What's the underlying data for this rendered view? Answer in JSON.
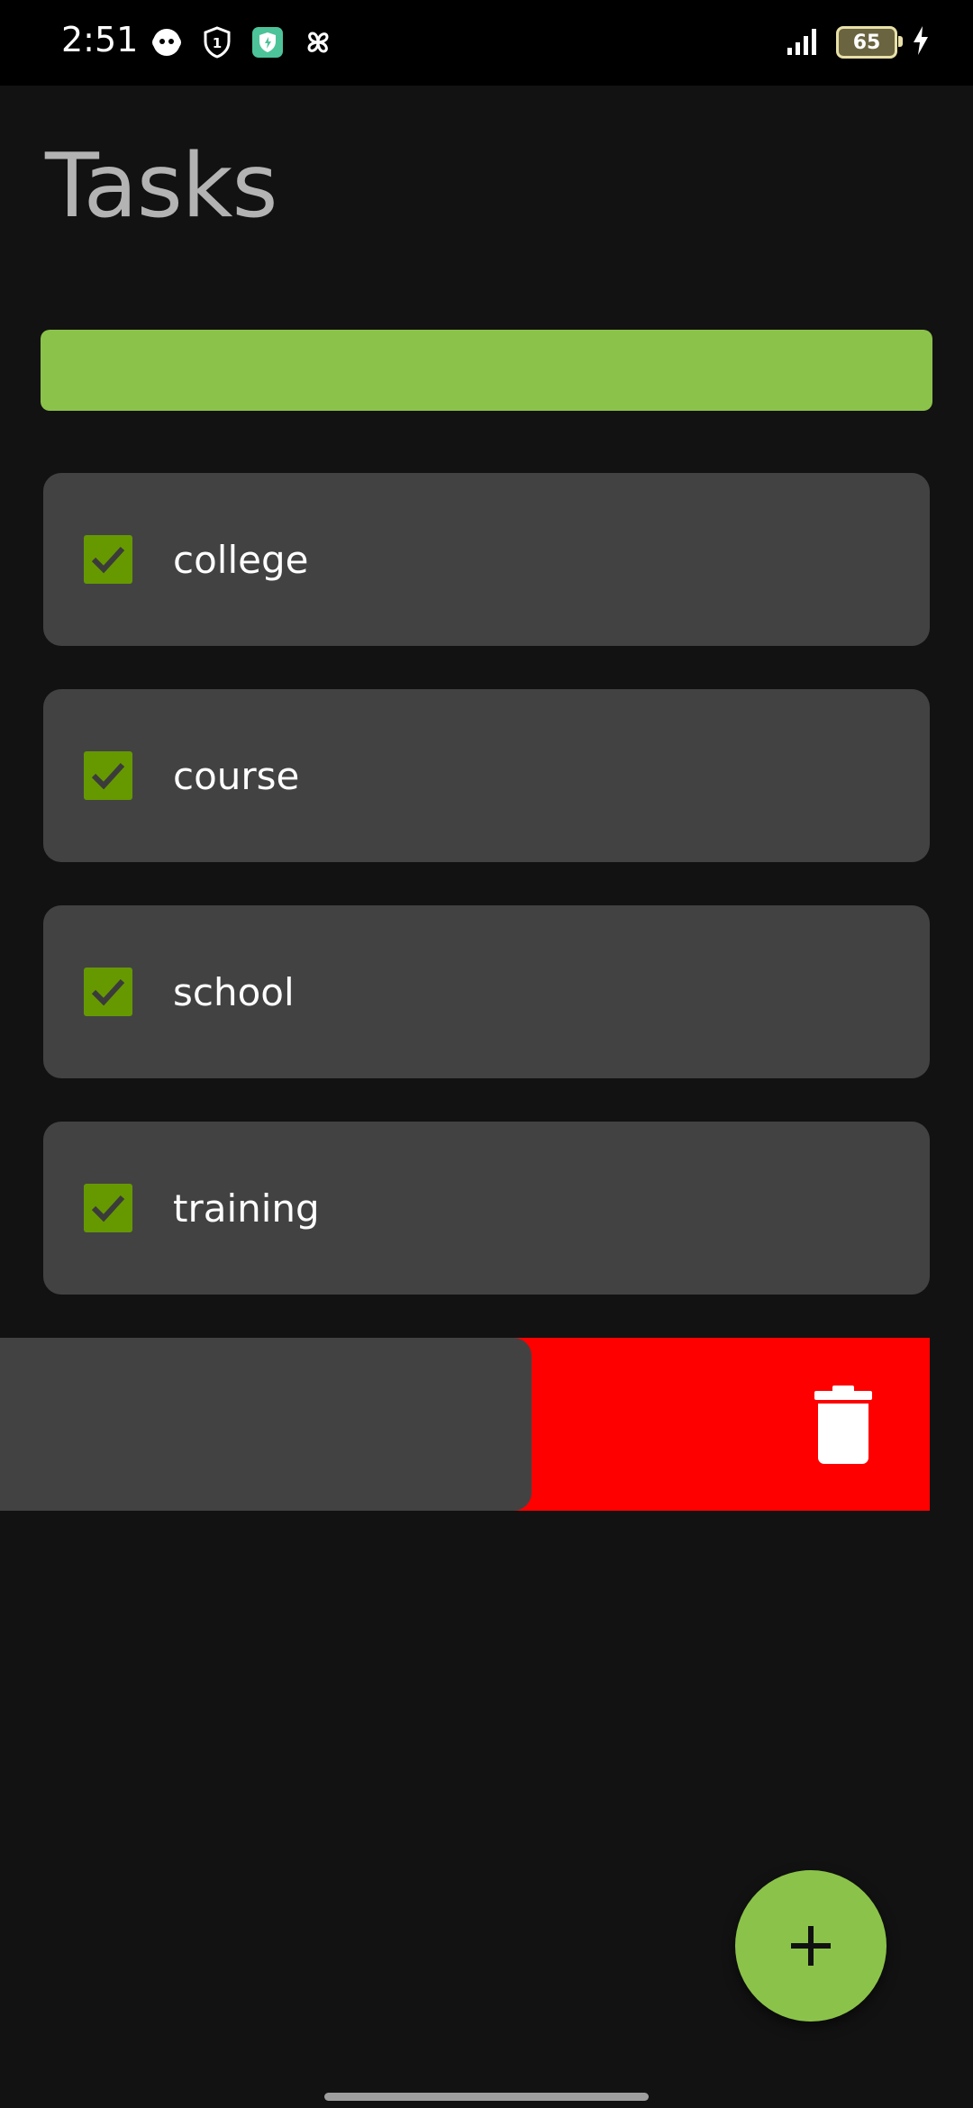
{
  "status_bar": {
    "time": "2:51",
    "battery_level": "65",
    "left_icons": [
      "assistant-icon",
      "shield-1-icon",
      "vpn-shield-icon",
      "pinwheel-icon"
    ],
    "right_icons": [
      "signal-icon",
      "battery-icon",
      "charging-icon"
    ]
  },
  "header": {
    "title": "Tasks"
  },
  "progress": {
    "completed_fraction": 1.0,
    "color": "#8bc34a"
  },
  "tasks": [
    {
      "label": "college",
      "checked": true
    },
    {
      "label": "course",
      "checked": true
    },
    {
      "label": "school",
      "checked": true
    },
    {
      "label": "training",
      "checked": true
    }
  ],
  "swipe_delete": {
    "icon": "trash-icon",
    "color": "#ff0000"
  },
  "fab": {
    "icon": "plus-icon",
    "color": "#8bc34a"
  },
  "colors": {
    "background": "#121212",
    "card": "#424242",
    "checkbox": "#669900",
    "title": "#b3b3b3"
  }
}
